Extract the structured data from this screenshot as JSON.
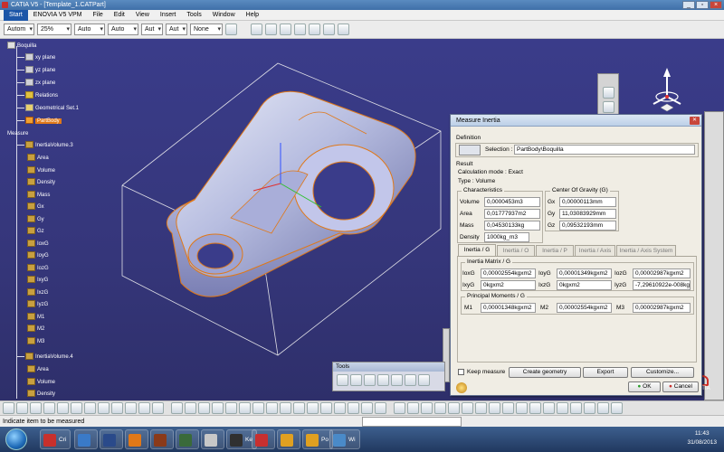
{
  "window": {
    "title": "CATIA V5 - [Template_1.CATPart]"
  },
  "menu": {
    "start": "Start",
    "items": [
      "ENOVIA V5 VPM",
      "File",
      "Edit",
      "View",
      "Insert",
      "Tools",
      "Window",
      "Help"
    ]
  },
  "options_bar": {
    "combo1": "Autom",
    "zoom": "25%",
    "combo3": "Auto",
    "combo4": "Auto",
    "combo5": "Aut",
    "combo6": "Aut",
    "combo7": "None"
  },
  "tree": {
    "root": "Boquilla",
    "planes": [
      "xy plane",
      "yz plane",
      "zx plane"
    ],
    "relations": "Relations",
    "geoset": "Geometrical Set.1",
    "partbody": "PartBody",
    "measure": "Measure",
    "inertia1": "InertiaVolume.3",
    "inertia1_items": [
      "Area",
      "Volume",
      "Density",
      "Mass",
      "Gx",
      "Gy",
      "Gz",
      "IoxG",
      "IoyG",
      "IozG",
      "IxyG",
      "IxzG",
      "IyzG",
      "M1",
      "M2",
      "M3"
    ],
    "inertia2": "InertiaVolume.4",
    "inertia2_items": [
      "Area",
      "Volume",
      "Density"
    ]
  },
  "dialog": {
    "title": "Measure Inertia",
    "definition": "Definition",
    "selection_label": "Selection :",
    "selection_value": "PartBody\\Boquilla",
    "result": "Result",
    "calc_mode": "Calculation mode :  Exact",
    "type": "Type :  Volume",
    "characteristics": "Characteristics",
    "cog": "Center Of Gravity (G)",
    "volume_label": "Volume",
    "volume_value": "0,0000453m3",
    "area_label": "Area",
    "area_value": "0,01777937m2",
    "mass_label": "Mass",
    "mass_value": "0,04530133kg",
    "density_label": "Density",
    "density_value": "1000kg_m3",
    "gx_label": "Gx",
    "gx_value": "0,00000113mm",
    "gy_label": "Gy",
    "gy_value": "11,03083929mm",
    "gz_label": "Gz",
    "gz_value": "0,09532193mm",
    "tabs": [
      "Inertia / G",
      "Inertia / O",
      "Inertia / P",
      "Inertia / Axis",
      "Inertia / Axis System"
    ],
    "inertia_matrix": "Inertia Matrix / G",
    "ioxg_label": "IoxG",
    "ioxg_value": "0,00002554kgxm2",
    "ioyg_label": "IoyG",
    "ioyg_value": "0,00001349kgxm2",
    "iozg_label": "IozG",
    "iozg_value": "0,00002987kgxm2",
    "ixyg_label": "IxyG",
    "ixyg_value": "0kgxm2",
    "ixzg_label": "IxzG",
    "ixzg_value": "0kgxm2",
    "iyzg_label": "IyzG",
    "iyzg_value": "-7,29610922e-008kgxm2",
    "principal": "Principal Moments / G",
    "m1_label": "M1",
    "m1_value": "0,00001348kgxm2",
    "m2_label": "M2",
    "m2_value": "0,00002554kgxm2",
    "m3_label": "M3",
    "m3_value": "0,00002987kgxm2",
    "keep_measure": "Keep measure",
    "create_geometry": "Create geometry",
    "export": "Export",
    "customize": "Customize...",
    "ok": "OK",
    "cancel": "Cancel"
  },
  "tools_toolbar": {
    "title": "Tools"
  },
  "status": {
    "text": "Indicate item to be measured"
  },
  "taskbar": {
    "items": [
      "Cri",
      "",
      "",
      "",
      "",
      "",
      "",
      "Ke",
      "",
      "",
      "Po",
      "Wi"
    ],
    "time": "11:43",
    "date": "31/08/2013"
  },
  "colors": {
    "viewport": "#35367a",
    "accent_orange": "#e07818",
    "dialog_bg": "#f0ede4"
  },
  "icons": [
    "catia-icon",
    "compass-icon",
    "catia-logo-icon",
    "windows-start-icon"
  ]
}
